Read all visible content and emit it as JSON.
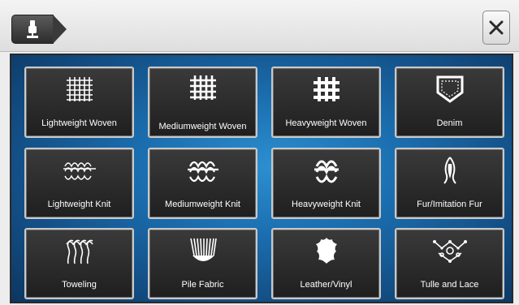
{
  "header": {
    "tab_icon": "presser-foot-icon",
    "close_icon": "close-icon"
  },
  "fabrics": [
    {
      "label": "Lightweight Woven",
      "icon": "lightweight-woven-icon"
    },
    {
      "label": "Mediumweight Woven",
      "icon": "mediumweight-woven-icon"
    },
    {
      "label": "Heavyweight Woven",
      "icon": "heavyweight-woven-icon"
    },
    {
      "label": "Denim",
      "icon": "denim-pocket-icon"
    },
    {
      "label": "Lightweight Knit",
      "icon": "lightweight-knit-icon"
    },
    {
      "label": "Mediumweight Knit",
      "icon": "mediumweight-knit-icon"
    },
    {
      "label": "Heavyweight Knit",
      "icon": "heavyweight-knit-icon"
    },
    {
      "label": "Fur/Imitation Fur",
      "icon": "fur-icon"
    },
    {
      "label": "Toweling",
      "icon": "toweling-icon"
    },
    {
      "label": "Pile Fabric",
      "icon": "pile-fabric-icon"
    },
    {
      "label": "Leather/Vinyl",
      "icon": "leather-hide-icon"
    },
    {
      "label": "Tulle and Lace",
      "icon": "lace-icon"
    }
  ]
}
